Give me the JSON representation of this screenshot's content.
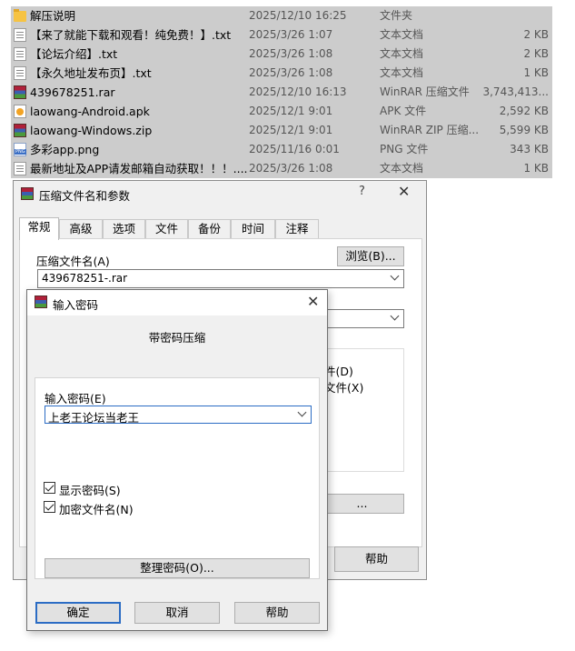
{
  "files": [
    {
      "icon": "folder-icon",
      "name": "解压说明",
      "date": "2025/12/10 16:25",
      "type": "文件夹",
      "size": ""
    },
    {
      "icon": "text-file-icon",
      "name": "【来了就能下载和观看！纯免费！】.txt",
      "date": "2025/3/26 1:07",
      "type": "文本文档",
      "size": "2 KB"
    },
    {
      "icon": "text-file-icon",
      "name": "【论坛介绍】.txt",
      "date": "2025/3/26 1:08",
      "type": "文本文档",
      "size": "2 KB"
    },
    {
      "icon": "text-file-icon",
      "name": "【永久地址发布页】.txt",
      "date": "2025/3/26 1:08",
      "type": "文本文档",
      "size": "1 KB"
    },
    {
      "icon": "winrar-archive-icon",
      "name": "439678251.rar",
      "date": "2025/12/10 16:13",
      "type": "WinRAR 压缩文件",
      "size": "3,743,413..."
    },
    {
      "icon": "apk-file-icon",
      "name": "laowang-Android.apk",
      "date": "2025/12/1 9:01",
      "type": "APK 文件",
      "size": "2,592 KB"
    },
    {
      "icon": "winrar-archive-icon",
      "name": "laowang-Windows.zip",
      "date": "2025/12/1 9:01",
      "type": "WinRAR ZIP 压缩...",
      "size": "5,599 KB"
    },
    {
      "icon": "png-file-icon",
      "name": "多彩app.png",
      "date": "2025/11/16 0:01",
      "type": "PNG 文件",
      "size": "343 KB"
    },
    {
      "icon": "text-file-icon",
      "name": "最新地址及APP请发邮箱自动获取！！！....",
      "date": "2025/3/26 1:08",
      "type": "文本文档",
      "size": "1 KB"
    }
  ],
  "main_dialog": {
    "title": "压缩文件名和参数",
    "help_glyph": "?",
    "close_glyph": "✕",
    "tabs": [
      "常规",
      "高级",
      "选项",
      "文件",
      "备份",
      "时间",
      "注释"
    ],
    "archive_name_label": "压缩文件名(A)",
    "browse_label": "浏览(B)...",
    "archive_name_value": "439678251-.rar",
    "option_1_partial": "件(D)",
    "option_2_partial": "文件(X)",
    "partial_button_label": "...",
    "help_label": "帮助"
  },
  "password_dialog": {
    "title": "输入密码",
    "close_glyph": "✕",
    "heading": "带密码压缩",
    "input_label": "输入密码(E)",
    "input_value": "上老王论坛当老王",
    "show_password_label": "显示密码(S)",
    "show_password_checked": true,
    "encrypt_names_label": "加密文件名(N)",
    "encrypt_names_checked": true,
    "organize_button": "整理密码(O)...",
    "ok_button": "确定",
    "cancel_button": "取消",
    "help_button": "帮助"
  }
}
